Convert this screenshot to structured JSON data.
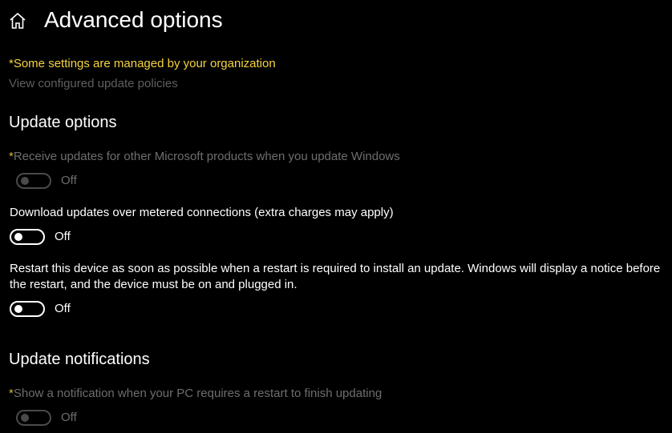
{
  "header": {
    "home_icon": "home-icon",
    "title": "Advanced options"
  },
  "notice": {
    "managed_text": "*Some settings are managed by your organization",
    "view_policies_link": "View configured update policies",
    "managed_color": "#f5d33e"
  },
  "sections": {
    "update_options": {
      "title": "Update options",
      "settings": [
        {
          "asterisk": "*",
          "label": "Receive updates for other Microsoft products when you update Windows",
          "state": "Off",
          "enabled": false
        },
        {
          "asterisk": "",
          "label": "Download updates over metered connections (extra charges may apply)",
          "state": "Off",
          "enabled": true
        },
        {
          "asterisk": "",
          "label_line1": "Restart this device as soon as possible when a restart is required to install an update. Windows will display a notice before",
          "label_line2": "the restart, and the device must be on and plugged in.",
          "state": "Off",
          "enabled": true
        }
      ]
    },
    "update_notifications": {
      "title": "Update notifications",
      "settings": [
        {
          "asterisk": "*",
          "label": "Show a notification when your PC requires a restart to finish updating",
          "state": "Off",
          "enabled": false
        }
      ]
    }
  }
}
